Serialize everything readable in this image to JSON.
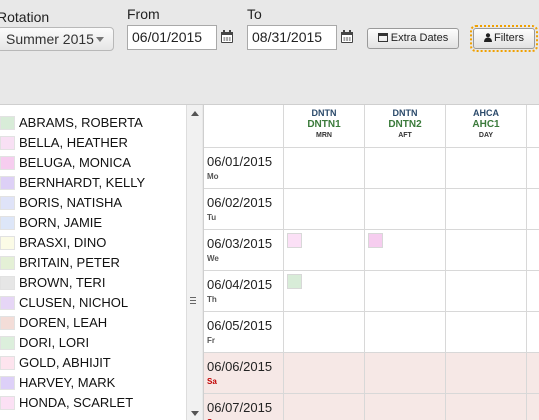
{
  "filters": {
    "rotation_label": "Rotation",
    "rotation_value": "Summer 2015",
    "from_label": "From",
    "from_value": "06/01/2015",
    "to_label": "To",
    "to_value": "08/31/2015",
    "extra_dates_label": "Extra Dates",
    "filters_label": "Filters"
  },
  "people": [
    {
      "name": "ABRAMS, ROBERTA",
      "color": "#d8ecd8"
    },
    {
      "name": "BELLA, HEATHER",
      "color": "#f8e0f4"
    },
    {
      "name": "BELUGA, MONICA",
      "color": "#f6cdef"
    },
    {
      "name": "BERNHARDT, KELLY",
      "color": "#ddd0f6"
    },
    {
      "name": "BORIS, NATISHA",
      "color": "#dfe3f8"
    },
    {
      "name": "BORN, JAMIE",
      "color": "#dde6f8"
    },
    {
      "name": "BRASXI, DINO",
      "color": "#fbfbe6"
    },
    {
      "name": "BRITAIN, PETER",
      "color": "#e4f0d6"
    },
    {
      "name": "BROWN, TERI",
      "color": "#e6e6e6"
    },
    {
      "name": "CLUSEN, NICHOL",
      "color": "#e6d6f6"
    },
    {
      "name": "DOREN, LEAH",
      "color": "#f3ddd8"
    },
    {
      "name": "DORI, LORI",
      "color": "#dcefdc"
    },
    {
      "name": "GOLD, ABHIJIT",
      "color": "#fde4ee"
    },
    {
      "name": "HARVEY, MARK",
      "color": "#ddd0f8"
    },
    {
      "name": "HONDA, SCARLET",
      "color": "#fbe0f4"
    }
  ],
  "columns": [
    {
      "site": "DNTN",
      "code": "DNTN1",
      "shift": "MRN"
    },
    {
      "site": "DNTN",
      "code": "DNTN2",
      "shift": "AFT"
    },
    {
      "site": "AHCA",
      "code": "AHC1",
      "shift": "DAY"
    }
  ],
  "dates": [
    {
      "date": "06/01/2015",
      "dow": "Mo",
      "weekend": false
    },
    {
      "date": "06/02/2015",
      "dow": "Tu",
      "weekend": false
    },
    {
      "date": "06/03/2015",
      "dow": "We",
      "weekend": false
    },
    {
      "date": "06/04/2015",
      "dow": "Th",
      "weekend": false
    },
    {
      "date": "06/05/2015",
      "dow": "Fr",
      "weekend": false
    },
    {
      "date": "06/06/2015",
      "dow": "Sa",
      "weekend": true
    },
    {
      "date": "06/07/2015",
      "dow": "Su",
      "weekend": true
    }
  ],
  "assignments": [
    {
      "row": 2,
      "col": 1,
      "color": "#fbe0f6"
    },
    {
      "row": 2,
      "col": 2,
      "color": "#f6cdef"
    },
    {
      "row": 3,
      "col": 1,
      "color": "#d8ecd8"
    }
  ],
  "icons": {
    "calendar": "calendar-icon",
    "user": "user-icon",
    "dropdown": "chevron-down-icon"
  }
}
